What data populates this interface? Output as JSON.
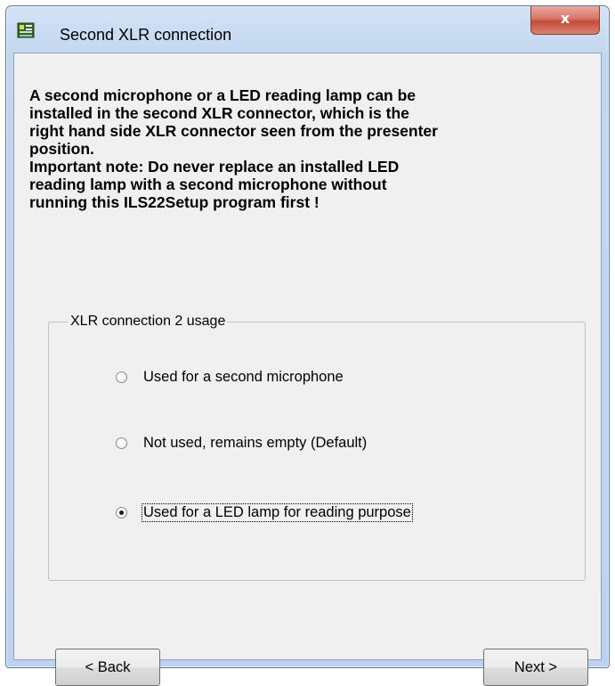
{
  "window": {
    "title": "Second XLR connection",
    "close_glyph": "x"
  },
  "description": "A second microphone or a LED reading lamp can be\ninstalled in the second XLR connector, which is the\nright hand side XLR connector seen from the presenter\nposition.\nImportant note: Do never replace an installed LED\nreading lamp with a second microphone without\nrunning this ILS22Setup program first !",
  "group": {
    "label": "XLR connection 2 usage",
    "options": [
      {
        "label": "Used for a second microphone",
        "selected": false
      },
      {
        "label": "Not used, remains empty (Default)",
        "selected": false
      },
      {
        "label": "Used for a LED lamp for reading purpose",
        "selected": true
      }
    ]
  },
  "buttons": {
    "back": "< Back",
    "next": "Next >"
  },
  "colors": {
    "title_bar": "#c1d6ef",
    "close_button": "#c44b3d",
    "dialog_face": "#f0f0f0"
  }
}
